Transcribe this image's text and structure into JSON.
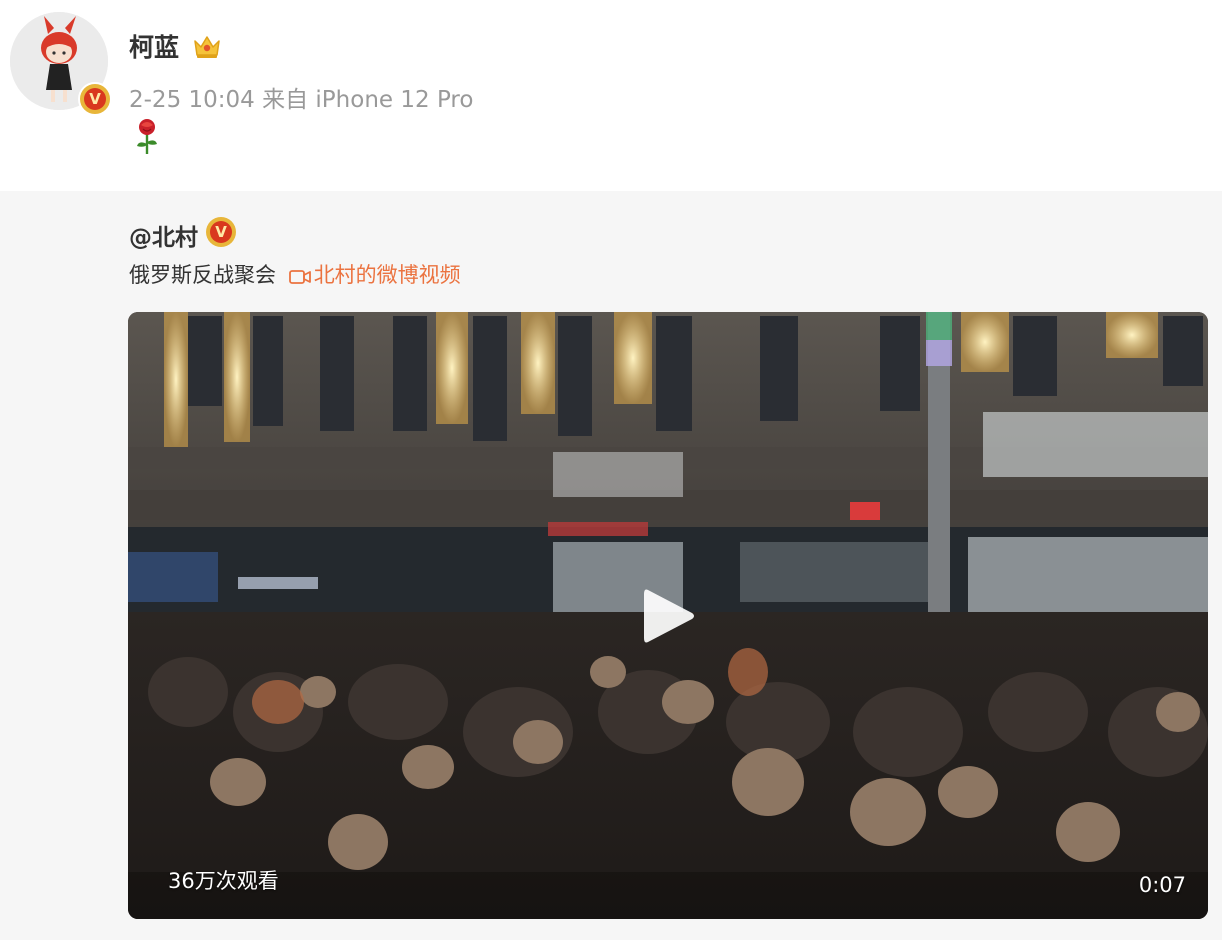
{
  "post": {
    "author": "柯蓝",
    "meta": "2-25 10:04  来自 iPhone 12 Pro",
    "avatar_icon": "cartoon-girl-avatar",
    "badge_icon": "crown-icon",
    "verified_mark": "V",
    "content_icon": "rose-icon"
  },
  "repost": {
    "author": "@北村",
    "verified_mark": "V",
    "text": "俄罗斯反战聚会",
    "video_link": "北村的微博视频",
    "link_color": "#eb7340"
  },
  "video": {
    "views": "36万次观看",
    "duration": "0:07",
    "play_icon": "play-icon"
  }
}
